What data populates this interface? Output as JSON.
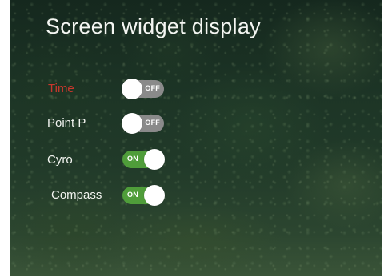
{
  "title": "Screen widget display",
  "colors": {
    "alert_label": "#c8372d",
    "toggle_on": "#4f9d3a",
    "toggle_off": "#8a8a8a"
  },
  "widgets": [
    {
      "label": "Time",
      "state": "OFF",
      "on": false
    },
    {
      "label": "Point P",
      "state": "OFF",
      "on": false
    },
    {
      "label": "Cyro",
      "state": "ON",
      "on": true
    },
    {
      "label": "Compass",
      "state": "ON",
      "on": true
    }
  ]
}
